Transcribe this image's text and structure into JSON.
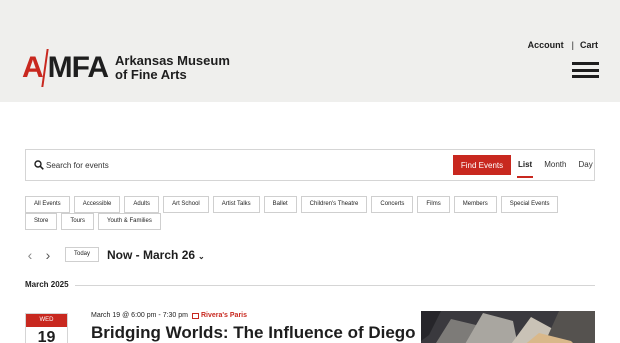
{
  "header": {
    "logo_mark_a": "A",
    "logo_mark_rest": "MFA",
    "logo_line1": "Arkansas Museum",
    "logo_line2": "of Fine Arts",
    "account_label": "Account",
    "separator": "|",
    "cart_label": "Cart"
  },
  "search": {
    "placeholder": "Search for events",
    "button_label": "Find Events",
    "views": [
      "List",
      "Month",
      "Day"
    ],
    "active_view": "List"
  },
  "filters": [
    "All Events",
    "Accessible",
    "Adults",
    "Art School",
    "Artist Talks",
    "Ballet",
    "Children's Theatre",
    "Concerts",
    "Films",
    "Members",
    "Special Events",
    "Store",
    "Tours",
    "Youth & Families"
  ],
  "nav": {
    "prev_icon": "chevron-left-icon",
    "next_icon": "chevron-right-icon",
    "today_label": "Today",
    "date_range": "Now - March 26",
    "caret": "⌄"
  },
  "month": {
    "label": "March 2025"
  },
  "event": {
    "dow": "WED",
    "day": "19",
    "time": "March 19 @ 6:00 pm - 7:30 pm",
    "series": "Rivera's Paris",
    "title": "Bridging Worlds: The Influence of Diego Rivera"
  },
  "colors": {
    "accent": "#c8281f",
    "header_bg": "#efefed",
    "text": "#1e1e1e"
  }
}
